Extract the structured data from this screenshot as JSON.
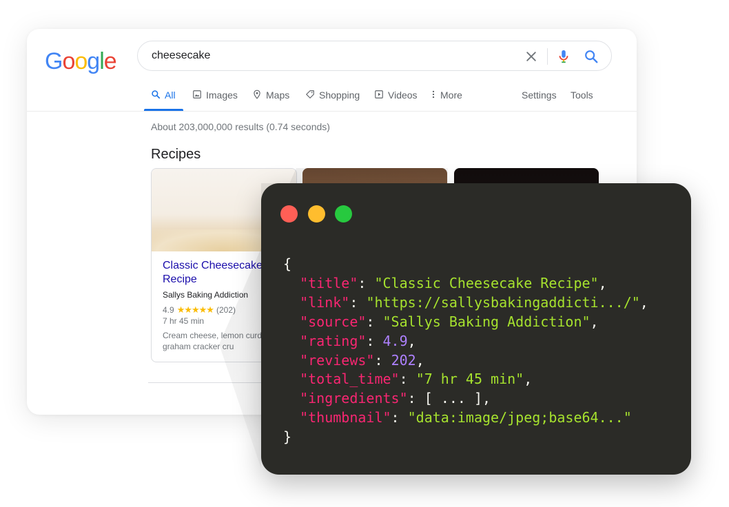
{
  "logo": {
    "letters": [
      "G",
      "o",
      "o",
      "g",
      "l",
      "e"
    ],
    "colors": [
      "#4285F4",
      "#EA4335",
      "#FBBC05",
      "#4285F4",
      "#34A853",
      "#EA4335"
    ]
  },
  "search": {
    "query": "cheesecake"
  },
  "tabs": [
    {
      "label": "All",
      "icon": "search-icon",
      "active": true
    },
    {
      "label": "Images",
      "icon": "image-icon"
    },
    {
      "label": "Maps",
      "icon": "map-pin-icon"
    },
    {
      "label": "Shopping",
      "icon": "tag-icon"
    },
    {
      "label": "Videos",
      "icon": "play-icon"
    },
    {
      "label": "More",
      "icon": "more-vert-icon"
    }
  ],
  "tools": {
    "settings": "Settings",
    "tools": "Tools"
  },
  "results_count": "About 203,000,000 results (0.74 seconds)",
  "recipes": {
    "heading": "Recipes",
    "cards": [
      {
        "title": "Classic Cheesecake Recipe",
        "source": "Sallys Baking Addiction",
        "rating": "4.9",
        "stars": "★★★★★",
        "reviews": "(202)",
        "time": "7 hr 45 min",
        "ingredients": "Cream cheese, lemon curd, cream, graham cracker cru"
      }
    ]
  },
  "code_window": {
    "lines": [
      "{",
      "  \"title\": \"Classic Cheesecake Recipe\",",
      "  \"link\": \"https://sallysbakingaddicti.../\",",
      "  \"source\": \"Sallys Baking Addiction\",",
      "  \"rating\": 4.9,",
      "  \"reviews\": 202,",
      "  \"total_time\": \"7 hr 45 min\",",
      "  \"ingredients\": [ ... ],",
      "  \"thumbnail\": \"data:image/jpeg;base64...\"",
      "}"
    ],
    "colors": {
      "key": "#f92672",
      "string": "#a6e22e",
      "number": "#ae81ff",
      "punct": "#f8f8f2",
      "bg": "#2b2b27"
    }
  }
}
